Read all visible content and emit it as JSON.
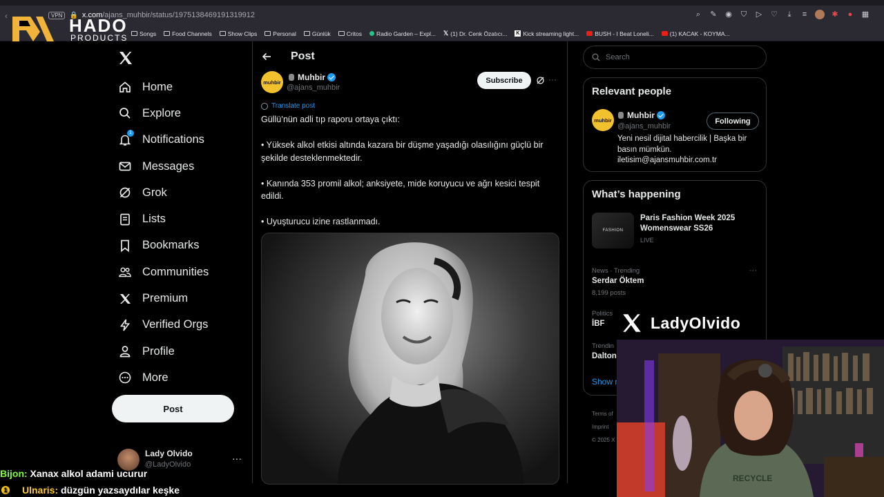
{
  "browser": {
    "url_domain": "x.com",
    "url_path": "/ajans_muhbir/status/1975138469191319912",
    "vpn_label": "VPN",
    "bookmarks": [
      {
        "label": "Songs",
        "icon": "folder-icon"
      },
      {
        "label": "Food Channels",
        "icon": "folder-icon"
      },
      {
        "label": "Show Clips",
        "icon": "folder-icon"
      },
      {
        "label": "Personal",
        "icon": "folder-icon"
      },
      {
        "label": "Günlük",
        "icon": "folder-icon"
      },
      {
        "label": "Critos",
        "icon": "folder-icon"
      },
      {
        "label": "Radio Garden – Expl...",
        "icon": "radio-icon"
      },
      {
        "label": "(1) Dr. Cenk Özatıcı...",
        "icon": "x-icon"
      },
      {
        "label": "Kick streaming light...",
        "icon": "kick-icon"
      },
      {
        "label": "BUSH - I Beat Loneli...",
        "icon": "youtube-icon"
      },
      {
        "label": "(1) KACAK - KOYMA...",
        "icon": "youtube-icon"
      }
    ]
  },
  "overlay_logo": {
    "title": "HADO",
    "subtitle": "PRODUCTS"
  },
  "sidebar": {
    "items": [
      {
        "label": "Home",
        "icon": "home-icon"
      },
      {
        "label": "Explore",
        "icon": "search-icon"
      },
      {
        "label": "Notifications",
        "icon": "bell-icon",
        "badge": "1"
      },
      {
        "label": "Messages",
        "icon": "mail-icon"
      },
      {
        "label": "Grok",
        "icon": "grok-icon"
      },
      {
        "label": "Lists",
        "icon": "list-icon"
      },
      {
        "label": "Bookmarks",
        "icon": "bookmark-icon"
      },
      {
        "label": "Communities",
        "icon": "communities-icon"
      },
      {
        "label": "Premium",
        "icon": "x-icon"
      },
      {
        "label": "Verified Orgs",
        "icon": "lightning-icon"
      },
      {
        "label": "Profile",
        "icon": "person-icon"
      },
      {
        "label": "More",
        "icon": "more-circle-icon"
      }
    ],
    "post_button": "Post",
    "account": {
      "name": "Lady Olvido",
      "handle": "@LadyOlvido"
    }
  },
  "main": {
    "title": "Post",
    "author": {
      "name": "Muhbir",
      "handle": "@ajans_muhbir",
      "avatar_text": "muhbir"
    },
    "subscribe": "Subscribe",
    "translate": "Translate post",
    "paragraphs": [
      "Güllü’nün adli tıp raporu ortaya çıktı:",
      "• Yüksek alkol etkisi altında kazara bir düşme yaşadığı olasılığını güçlü bir şekilde desteklenmektedir.",
      "• Kanında 353 promil alkol; anksiyete, mide koruyucu ve ağrı kesici tespit edildi.",
      "• Uyuşturucu izine rastlanmadı."
    ]
  },
  "right": {
    "search_placeholder": "Search",
    "relevant": {
      "title": "Relevant people",
      "name": "Muhbir",
      "handle": "@ajans_muhbir",
      "button": "Following",
      "bio": "Yeni nesil dijital habercilik | Başka bir basın mümkün. iletisim@ajansmuhbir.com.tr",
      "avatar_text": "muhbir"
    },
    "happening": {
      "title": "What’s happening",
      "featured": {
        "title": "Paris Fashion Week 2025 Womenswear SS26",
        "status": "LIVE",
        "thumb_text": "FASHION"
      },
      "trends": [
        {
          "meta": "News · Trending",
          "name": "Serdar Öktem",
          "count": "8,199 posts"
        },
        {
          "meta": "Politics",
          "name": "İBF",
          "count": ""
        },
        {
          "meta": "Trendin",
          "name": "Dalton",
          "count": ""
        }
      ],
      "show_more": "Show m"
    },
    "footer": [
      "Terms of",
      "Imprint",
      "© 2025 X"
    ]
  },
  "stream_brand": "LadyOlvido",
  "chat": [
    {
      "user": "Bijon:",
      "message": "Xanax alkol adami ucurur"
    },
    {
      "user": "Ulnaris:",
      "message": "düzgün yazsaydılar keşke",
      "badge": "1"
    }
  ],
  "colors": {
    "accent": "#1d9bf0",
    "background": "#000000",
    "border": "#2f3336",
    "muted": "#71767b"
  }
}
